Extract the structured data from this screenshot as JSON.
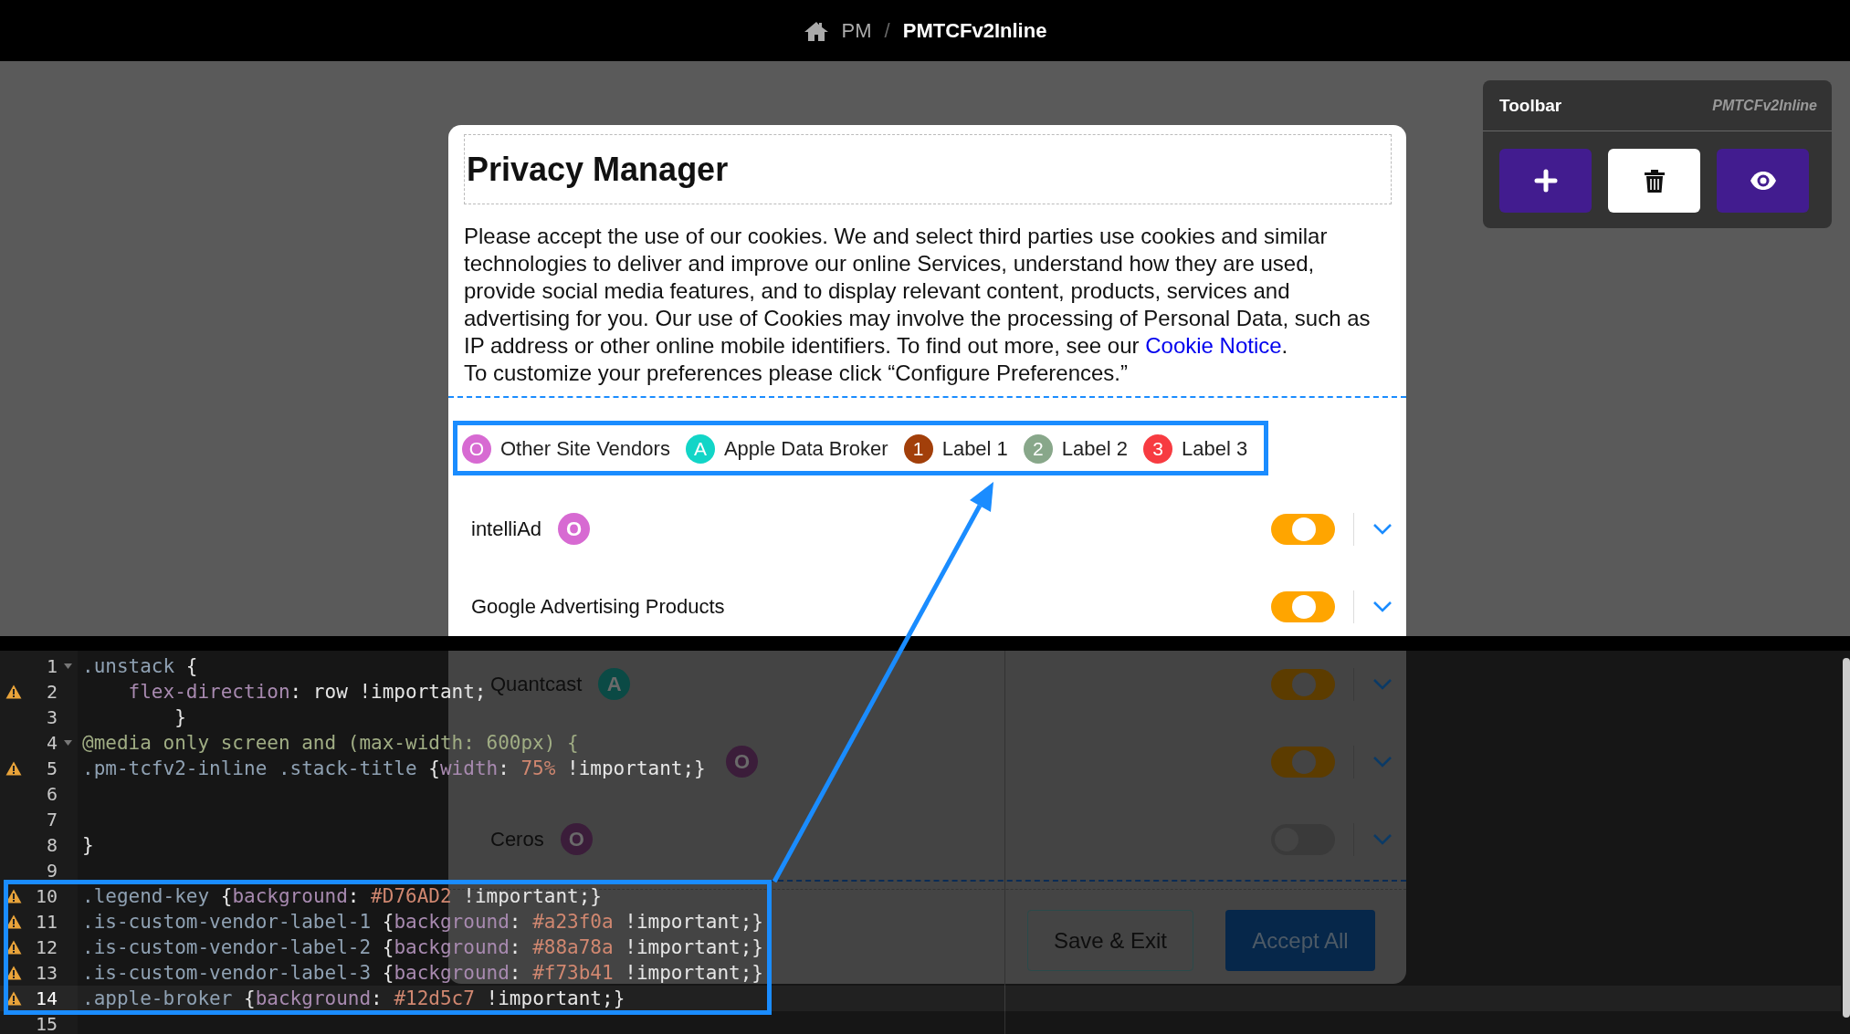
{
  "breadcrumb": {
    "root": "PM",
    "separator": "/",
    "current": "PMTCFv2Inline"
  },
  "toolbar": {
    "title": "Toolbar",
    "subtitle": "PMTCFv2Inline",
    "buttons": [
      {
        "kind": "add"
      },
      {
        "kind": "delete"
      },
      {
        "kind": "preview"
      }
    ]
  },
  "modal": {
    "title": "Privacy Manager",
    "message_before": "Please accept the use of our cookies. We and select third parties use cookies and similar technologies to deliver and improve our online Services, understand how they are used, provide social media features, and to display relevant content, products, services and advertising for you. Our use of Cookies may involve the processing of Personal Data, such as IP address or other online mobile identifiers. To find out more, see our ",
    "link": "Cookie Notice",
    "message_after": ".",
    "instruction": "To customize your preferences please click “Configure Preferences.”",
    "legend": [
      {
        "letter": "O",
        "label": "Other Site Vendors",
        "color": "#d76ad2"
      },
      {
        "letter": "A",
        "label": "Apple Data Broker",
        "color": "#12d5c7"
      },
      {
        "letter": "1",
        "label": "Label 1",
        "color": "#a23f0a"
      },
      {
        "letter": "2",
        "label": "Label 2",
        "color": "#88a78a"
      },
      {
        "letter": "3",
        "label": "Label 3",
        "color": "#f73b41"
      }
    ],
    "vendors": [
      {
        "name": "intelliAd",
        "badge": "O",
        "color": "#d76ad2",
        "on": true
      },
      {
        "name": "Google Advertising Products",
        "on": true
      },
      {
        "name": "Quantcast",
        "badge": "A",
        "color": "#0b4a45",
        "on": true
      },
      {
        "badge": "O",
        "color": "#3b1d3a",
        "on": true
      },
      {
        "name": "Ceros",
        "badge": "O",
        "color": "#3b1d3a",
        "on": false
      }
    ],
    "buttons": [
      {
        "label": "Save & Exit",
        "kind": "secondary"
      },
      {
        "label": "Accept All",
        "kind": "primary"
      }
    ]
  },
  "editor": {
    "lines": [
      {
        "number": "1",
        "fold": true,
        "warning": false,
        "current": false,
        "tokens": [
          {
            "kind": "selector",
            "s": ".unstack "
          },
          {
            "kind": "plain",
            "s": "{"
          }
        ]
      },
      {
        "number": "2",
        "fold": false,
        "warning": true,
        "current": false,
        "tokens": [
          {
            "kind": "property",
            "s": "    flex-direction"
          },
          {
            "kind": "plain",
            "s": ": row !important;"
          }
        ]
      },
      {
        "number": "3",
        "fold": false,
        "warning": false,
        "current": false,
        "tokens": [
          {
            "kind": "plain",
            "s": "        }"
          }
        ]
      },
      {
        "number": "4",
        "fold": true,
        "warning": false,
        "current": false,
        "tokens": [
          {
            "kind": "media",
            "s": "@media only screen and (max-width: 600px) {"
          }
        ]
      },
      {
        "number": "5",
        "fold": false,
        "warning": true,
        "current": false,
        "tokens": [
          {
            "kind": "selector",
            "s": ".pm-tcfv2-inline .stack-title "
          },
          {
            "kind": "plain",
            "s": "{"
          },
          {
            "kind": "property",
            "s": "width"
          },
          {
            "kind": "plain",
            "s": ": "
          },
          {
            "kind": "number",
            "s": "75%"
          },
          {
            "kind": "plain",
            "s": " !important;}"
          }
        ]
      },
      {
        "number": "6",
        "fold": false,
        "warning": false,
        "current": false
      },
      {
        "number": "7",
        "fold": false,
        "warning": false,
        "current": false
      },
      {
        "number": "8",
        "fold": false,
        "warning": false,
        "current": false,
        "tokens": [
          {
            "kind": "plain",
            "s": "}"
          }
        ]
      },
      {
        "number": "9",
        "fold": false,
        "warning": false,
        "current": false
      },
      {
        "number": "10",
        "fold": false,
        "warning": true,
        "current": false,
        "tokens": [
          {
            "kind": "selector",
            "s": ".legend-key "
          },
          {
            "kind": "plain",
            "s": "{"
          },
          {
            "kind": "property",
            "s": "background"
          },
          {
            "kind": "plain",
            "s": ": "
          },
          {
            "kind": "number",
            "s": "#D76AD2"
          },
          {
            "kind": "plain",
            "s": " !important;}"
          }
        ]
      },
      {
        "number": "11",
        "fold": false,
        "warning": true,
        "current": false,
        "tokens": [
          {
            "kind": "selector",
            "s": ".is-custom-vendor-label-1 "
          },
          {
            "kind": "plain",
            "s": "{"
          },
          {
            "kind": "property",
            "s": "background"
          },
          {
            "kind": "plain",
            "s": ": "
          },
          {
            "kind": "number",
            "s": "#a23f0a"
          },
          {
            "kind": "plain",
            "s": " !important;}"
          }
        ]
      },
      {
        "number": "12",
        "fold": false,
        "warning": true,
        "current": false,
        "tokens": [
          {
            "kind": "selector",
            "s": ".is-custom-vendor-label-2 "
          },
          {
            "kind": "plain",
            "s": "{"
          },
          {
            "kind": "property",
            "s": "background"
          },
          {
            "kind": "plain",
            "s": ": "
          },
          {
            "kind": "number",
            "s": "#88a78a"
          },
          {
            "kind": "plain",
            "s": " !important;}"
          }
        ]
      },
      {
        "number": "13",
        "fold": false,
        "warning": true,
        "current": false,
        "tokens": [
          {
            "kind": "selector",
            "s": ".is-custom-vendor-label-3 "
          },
          {
            "kind": "plain",
            "s": "{"
          },
          {
            "kind": "property",
            "s": "background"
          },
          {
            "kind": "plain",
            "s": ": "
          },
          {
            "kind": "number",
            "s": "#f73b41"
          },
          {
            "kind": "plain",
            "s": " !important;}"
          }
        ]
      },
      {
        "number": "14",
        "fold": false,
        "warning": true,
        "current": true,
        "tokens": [
          {
            "kind": "selector",
            "s": ".apple-broker "
          },
          {
            "kind": "plain",
            "s": "{"
          },
          {
            "kind": "property",
            "s": "background"
          },
          {
            "kind": "plain",
            "s": ": "
          },
          {
            "kind": "number",
            "s": "#12d5c7"
          },
          {
            "kind": "plain",
            "s": " !important;}"
          }
        ]
      },
      {
        "number": "15",
        "fold": false,
        "warning": false,
        "current": false
      }
    ]
  }
}
